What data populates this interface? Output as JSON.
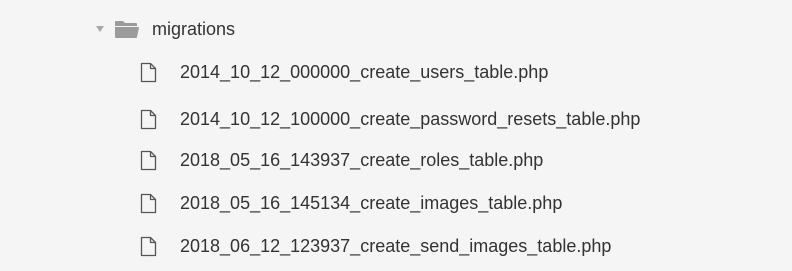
{
  "tree": {
    "folder": {
      "name": "migrations",
      "expanded": true,
      "icon": "folder-open-icon"
    },
    "files": [
      {
        "name": "2014_10_12_000000_create_users_table.php",
        "icon": "file-icon"
      },
      {
        "name": "2014_10_12_100000_create_password_resets_table.php",
        "icon": "file-icon"
      },
      {
        "name": "2018_05_16_143937_create_roles_table.php",
        "icon": "file-icon"
      },
      {
        "name": "2018_05_16_145134_create_images_table.php",
        "icon": "file-icon"
      },
      {
        "name": "2018_06_12_123937_create_send_images_table.php",
        "icon": "file-icon"
      }
    ]
  },
  "colors": {
    "background": "#f5f5f5",
    "text": "#333333",
    "icon": "#555555",
    "folder": "#9b9b9b",
    "chevron": "#a8a8a8"
  }
}
